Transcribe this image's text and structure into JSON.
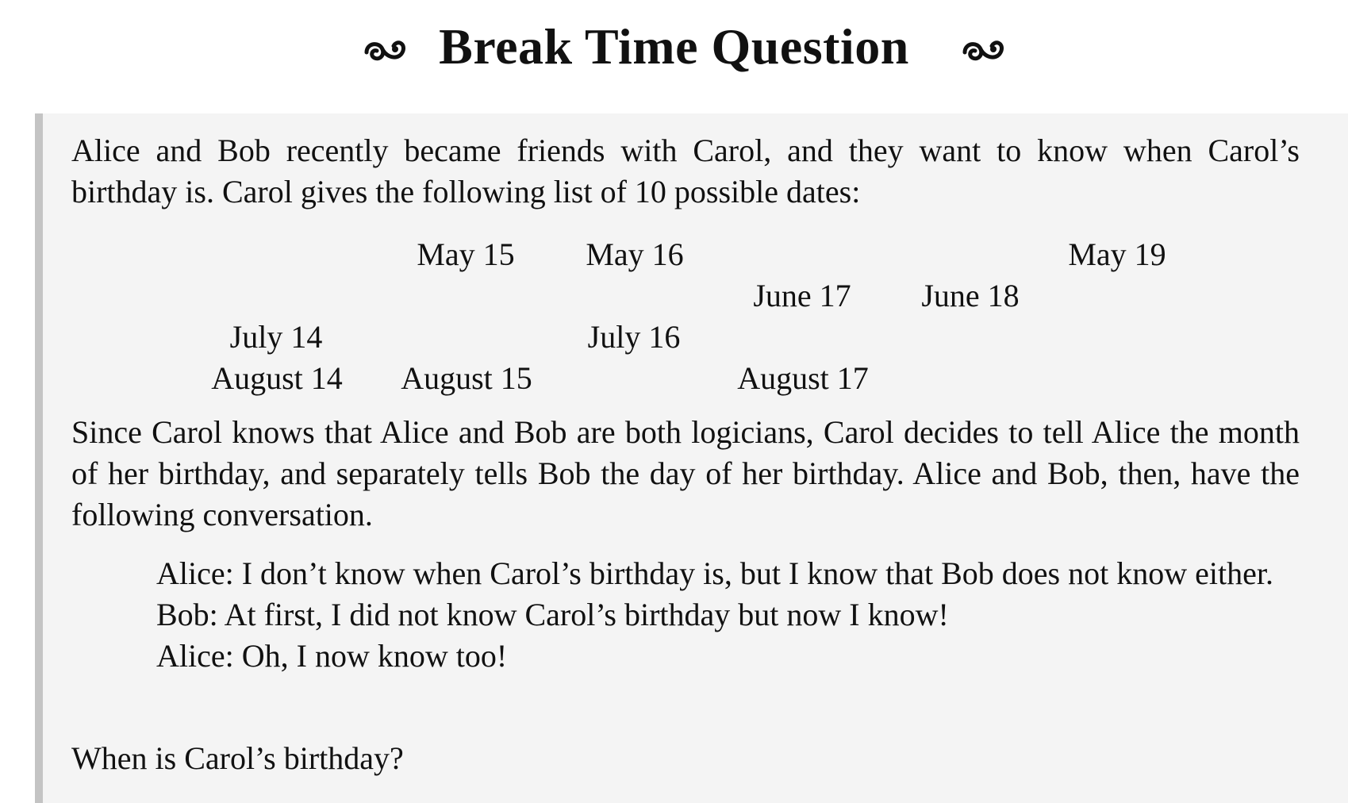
{
  "header": {
    "title": "Break Time Question",
    "flourish_icon": "fleuron-swirl-icon"
  },
  "intro": "Alice and Bob recently became friends with Carol, and they want to know when Carol’s birthday is. Carol gives the following list of 10 possible dates:",
  "dates": {
    "may_15": "May 15",
    "may_16": "May 16",
    "may_19": "May 19",
    "june_17": "June 17",
    "june_18": "June 18",
    "july_14": "July 14",
    "july_16": "July 16",
    "august_14": "August 14",
    "august_15": "August 15",
    "august_17": "August 17"
  },
  "setup": "Since Carol knows that Alice and Bob are both logicians, Carol decides to tell Alice the month of her birthday, and separately tells Bob the day of her birthday. Alice and Bob, then, have the following conversation.",
  "dialogue": [
    "Alice: I don’t know when Carol’s birthday is, but I know that Bob does not know either.",
    "Bob: At first, I did not know Carol’s birthday but now I know!",
    "Alice: Oh, I now know too!"
  ],
  "question": "When is Carol’s birthday?",
  "colors": {
    "panel_background": "#f4f4f4",
    "panel_border": "#c4c4c4",
    "text": "#111111"
  }
}
